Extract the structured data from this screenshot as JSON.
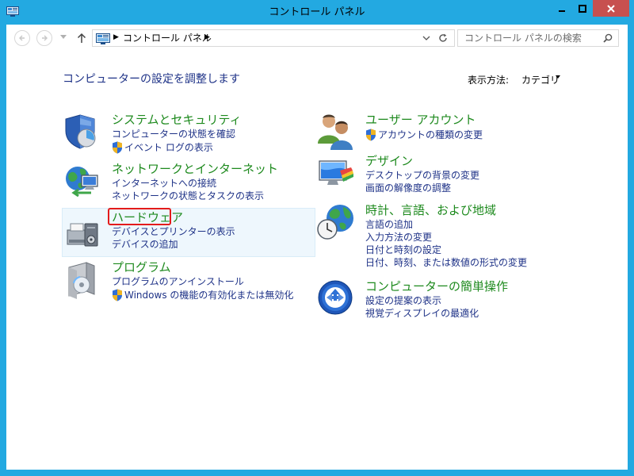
{
  "window": {
    "title": "コントロール パネル"
  },
  "address": {
    "path": "コントロール パネル"
  },
  "search": {
    "placeholder": "コントロール パネルの検索"
  },
  "page": {
    "title": "コンピューターの設定を調整します"
  },
  "view": {
    "label": "表示方法:",
    "value": "カテゴリ"
  },
  "categories": [
    {
      "title": "システムとセキュリティ",
      "icon": "shield-icon",
      "links": [
        "コンピューターの状態を確認",
        "イベント ログの表示"
      ]
    },
    {
      "title": "ネットワークとインターネット",
      "icon": "network-icon",
      "links": [
        "インターネットへの接続",
        "ネットワークの状態とタスクの表示"
      ]
    },
    {
      "title": "ハードウェア",
      "icon": "printer-icon",
      "links": [
        "デバイスとプリンターの表示",
        "デバイスの追加"
      ]
    },
    {
      "title": "プログラム",
      "icon": "programs-icon",
      "links": [
        "プログラムのアンインストール",
        "Windows の機能の有効化または無効化"
      ]
    },
    {
      "title": "ユーザー アカウント",
      "icon": "users-icon",
      "links": [
        "アカウントの種類の変更"
      ]
    },
    {
      "title": "デザイン",
      "icon": "display-icon",
      "links": [
        "デスクトップの背景の変更",
        "画面の解像度の調整"
      ]
    },
    {
      "title": "時計、言語、および地域",
      "icon": "clock-globe-icon",
      "links": [
        "言語の追加",
        "入力方法の変更",
        "日付と時刻の設定",
        "日付、時刻、または数値の形式の変更"
      ]
    },
    {
      "title": "コンピューターの簡単操作",
      "icon": "ease-of-access-icon",
      "links": [
        "設定の提案の表示",
        "視覚ディスプレイの最適化"
      ]
    }
  ],
  "colors": {
    "frame": "#23a9e1",
    "close_button": "#c7504f",
    "category_title": "#1e8a1e",
    "link": "#1e3287",
    "highlight": "#e31b1b"
  }
}
